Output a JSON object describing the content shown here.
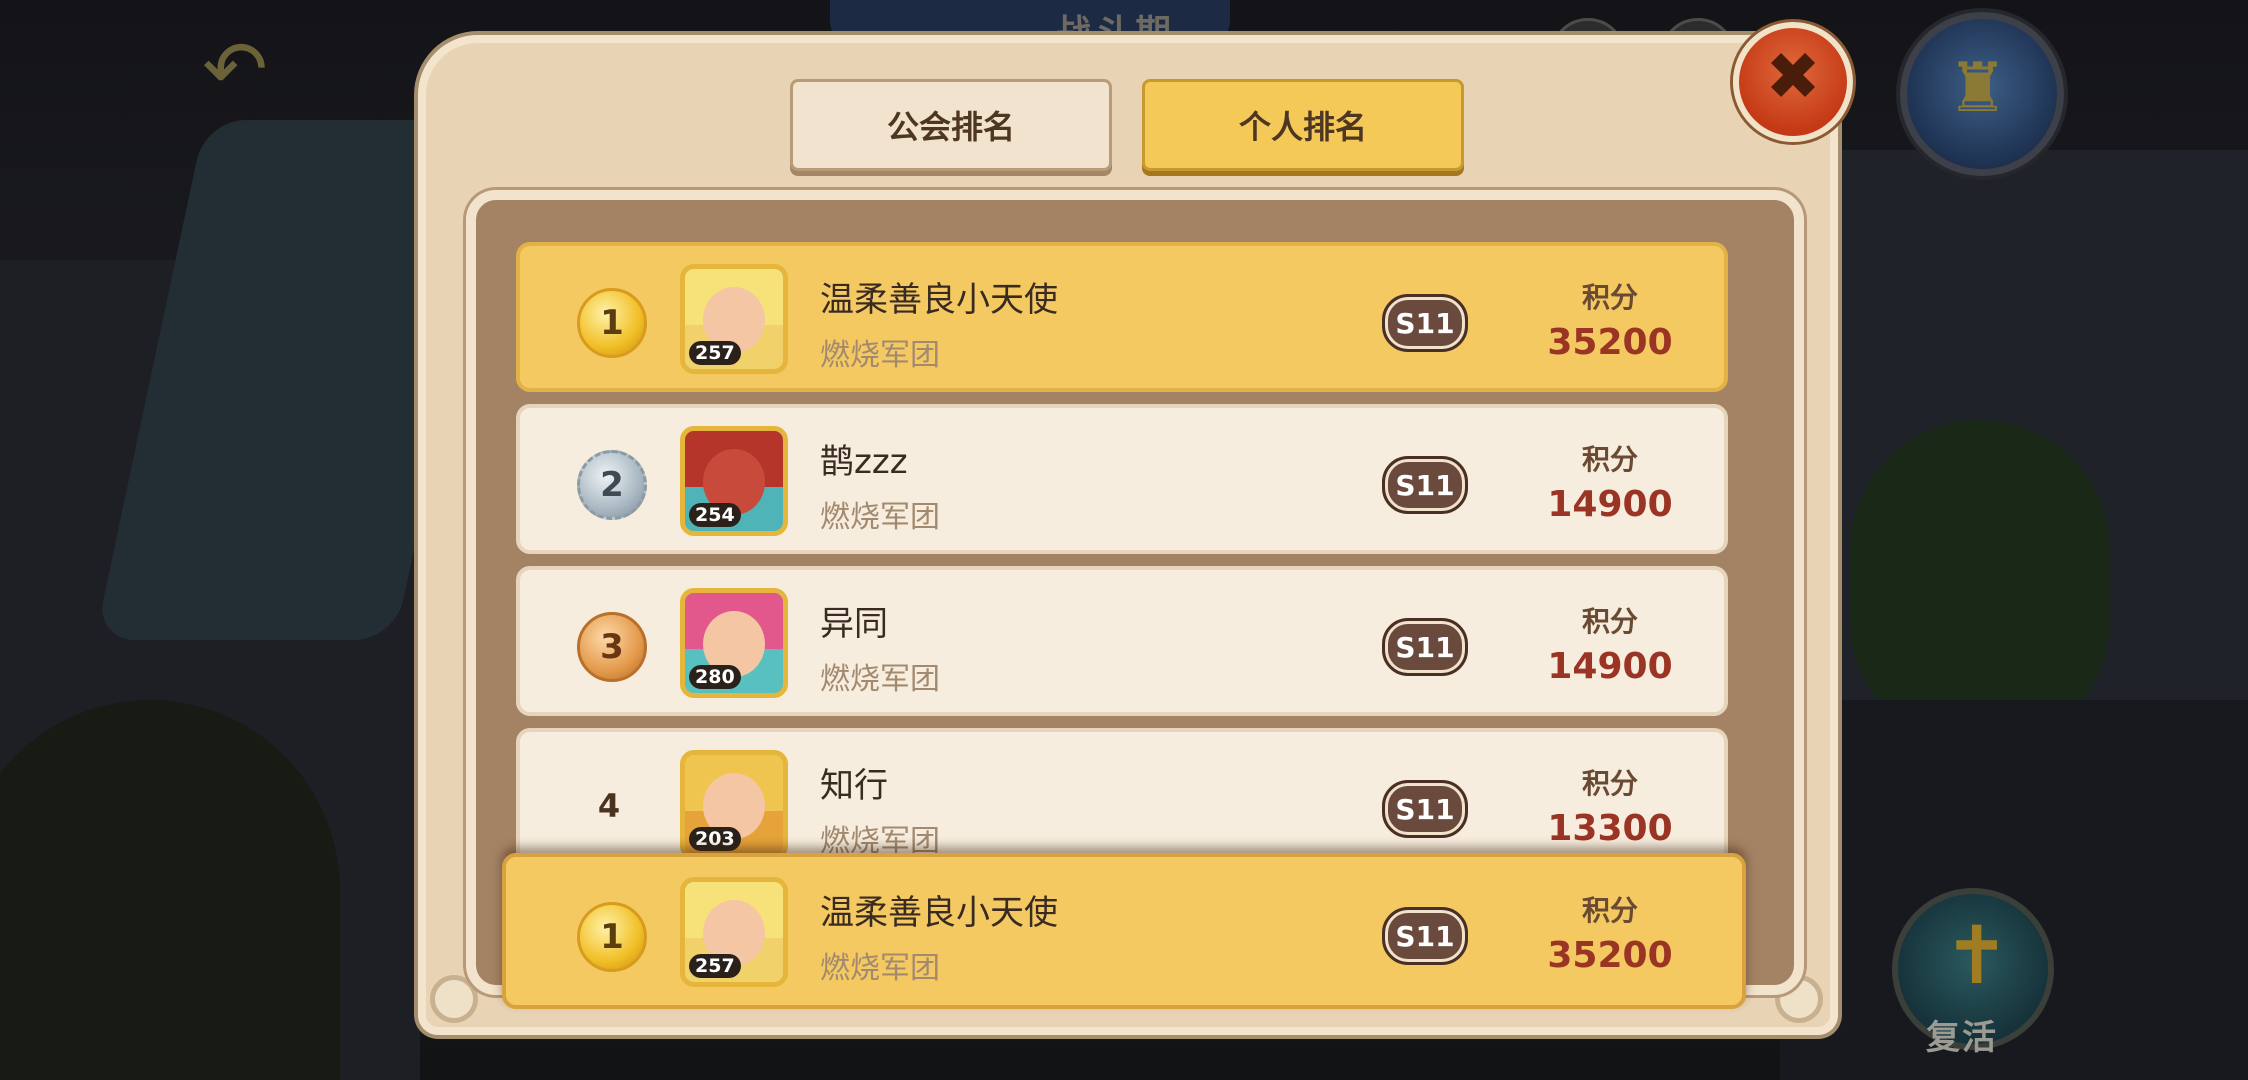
{
  "background": {
    "banner_text": "战斗期",
    "revive_label": "复活"
  },
  "icons": {
    "back": "back-arrow-icon",
    "close": "close-icon",
    "map": "map-icon",
    "revive": "revive-cross-icon"
  },
  "tabs": [
    {
      "label": "公会排名",
      "active": false
    },
    {
      "label": "个人排名",
      "active": true
    }
  ],
  "ranking": {
    "score_label": "积分",
    "rows": [
      {
        "rank": "1",
        "name": "温柔善良小天使",
        "guild": "燃烧军团",
        "level": "257",
        "season": "S11",
        "score": "35200",
        "medal": "gold"
      },
      {
        "rank": "2",
        "name": "鹊zzz",
        "guild": "燃烧军团",
        "level": "254",
        "season": "S11",
        "score": "14900",
        "medal": "silver"
      },
      {
        "rank": "3",
        "name": "异同",
        "guild": "燃烧军团",
        "level": "280",
        "season": "S11",
        "score": "14900",
        "medal": "bronze"
      },
      {
        "rank": "4",
        "name": "知行",
        "guild": "燃烧军团",
        "level": "203",
        "season": "S11",
        "score": "13300",
        "medal": "none"
      }
    ],
    "my_row": {
      "rank": "1",
      "name": "温柔善良小天使",
      "guild": "燃烧军团",
      "level": "257",
      "season": "S11",
      "score": "35200",
      "medal": "gold"
    }
  },
  "colors": {
    "tab_active": "#f5c957",
    "row_highlight": "#f4c962",
    "score_text": "#9a3424",
    "close_button": "#c53a16"
  }
}
